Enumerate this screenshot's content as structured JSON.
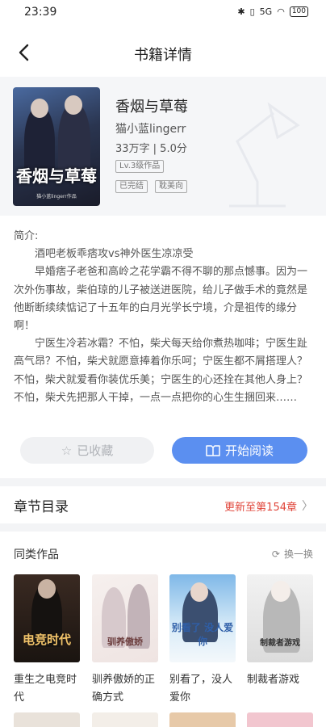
{
  "status": {
    "time": "23:39",
    "signal": "5G",
    "battery": "100"
  },
  "header": {
    "title": "书籍详情"
  },
  "book": {
    "title": "香烟与草莓",
    "author": "猫小蓝lingerr",
    "meta": "33万字 | 5.0分",
    "tags": [
      "Lv.3级作品",
      "已完结",
      "耽美向"
    ],
    "cover_title": "香烟与草莓",
    "cover_sub": "猫小蓝lingerr作品"
  },
  "intro": {
    "label": "简介:",
    "paragraphs": [
      "酒吧老板乖痞攻vs神外医生凉凉受",
      "早婚痞子老爸和高岭之花学霸不得不聊的那点憾事。因为一次外伤事故，柴伯琼的儿子被送进医院，给儿子做手术的竟然是他断断续续惦记了十五年的白月光学长宁境，介是祖传的缘分啊！",
      "宁医生冷若冰霜？不怕，柴犬每天给你煮热咖啡；宁医生趾高气昂？不怕，柴犬就愿意捧着你乐呵；宁医生都不屑搭理人？不怕，柴犬就爱看你装优乐美；宁医生的心还拴在其他人身上？不怕，柴犬先把那人干掉，一点一点把你的心生生捆回来……"
    ]
  },
  "actions": {
    "favorite": "已收藏",
    "read": "开始阅读"
  },
  "chapters": {
    "label": "章节目录",
    "update": "更新至第154章"
  },
  "similar": {
    "label": "同类作品",
    "refresh": "换一换",
    "items": [
      {
        "title": "重生之电竞时代",
        "cover_text": "电竞时代"
      },
      {
        "title": "驯养傲娇的正确方式",
        "cover_text": "驯养傲娇"
      },
      {
        "title": "别看了，没人爱你",
        "cover_text": "别看了 没人爱你"
      },
      {
        "title": "制裁者游戏",
        "cover_text": "制裁者游戏"
      }
    ]
  },
  "colors": {
    "accent": "#5b8ff0",
    "update_red": "#e0453a",
    "panel_bg": "#f5f6f8"
  }
}
